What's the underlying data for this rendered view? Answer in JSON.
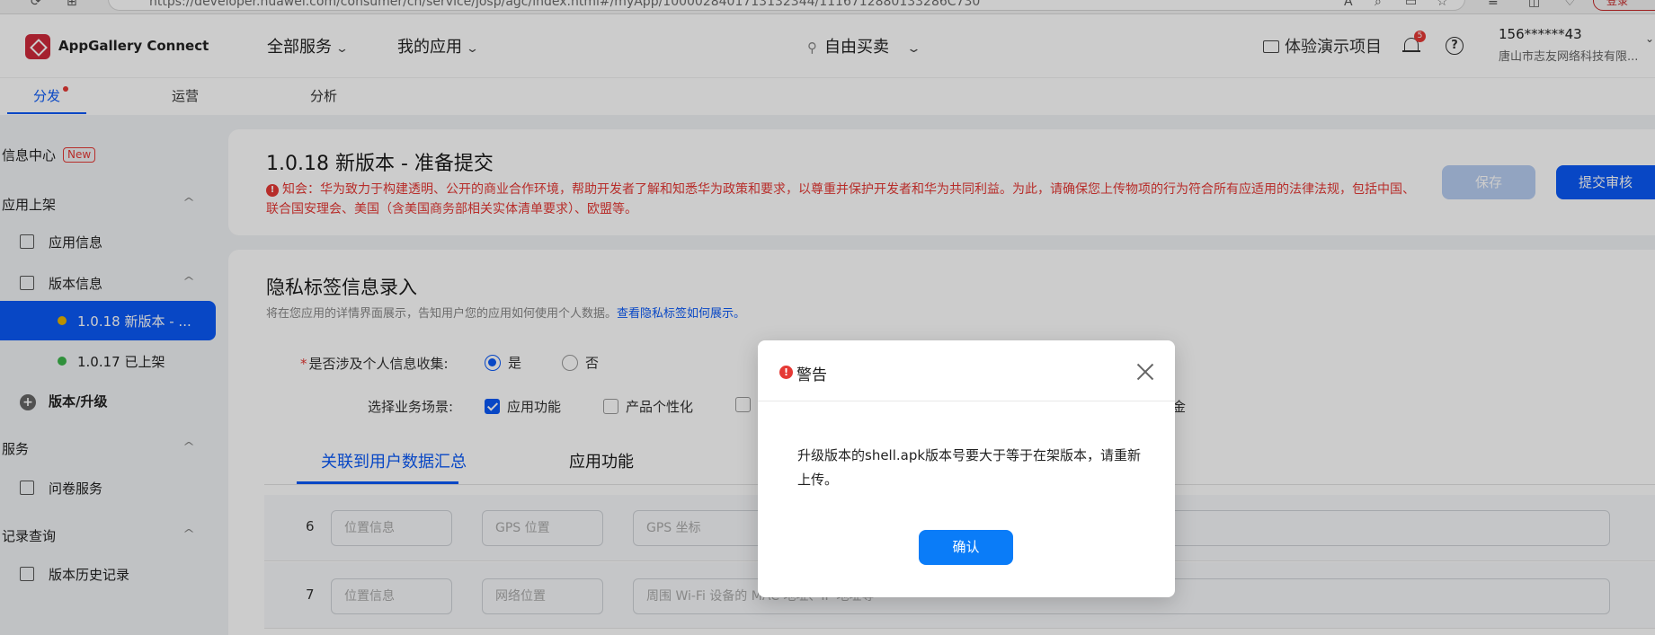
{
  "browser": {
    "url": "https://developer.huawei.com/consumer/cn/service/josp/agc/index.html#/myApp/1000028401713132344/1116712880133286C730",
    "login_label": "登录"
  },
  "header": {
    "brand": "AppGallery Connect",
    "nav_all_services": "全部服务",
    "nav_my_apps": "我的应用",
    "store_name": "自由买卖",
    "demo_project": "体验演示项目",
    "notification_count": "5",
    "help_glyph": "?",
    "user_id": "156******43",
    "user_org": "唐山市志友网络科技有限..."
  },
  "subnav": {
    "tabs": [
      "分发",
      "运营",
      "分析"
    ],
    "active_index": 0
  },
  "sidebar": {
    "info_center": "信息中心",
    "new_badge": "New",
    "section_listing": "应用上架",
    "app_info": "应用信息",
    "version_info": "版本信息",
    "version_current": "1.0.18 新版本 - ...",
    "version_live": "1.0.17 已上架",
    "version_upgrade": "版本/升级",
    "section_service": "服务",
    "survey_service": "问卷服务",
    "section_records": "记录查询",
    "version_history": "版本历史记录"
  },
  "top_card": {
    "title": "1.0.18 新版本 - 准备提交",
    "notice": "知会：华为致力于构建透明、公开的商业合作环境，帮助开发者了解和知悉华为政策和要求，以尊重并保护开发者和华为共同利益。为此，请确保您上传物项的行为符合所有应适用的法律法规，包括中国、联合国安理会、美国（含美国商务部相关实体清单要求）、欧盟等。",
    "save_label": "保存",
    "submit_label": "提交审核"
  },
  "privacy": {
    "title": "隐私标签信息录入",
    "desc": "将在您应用的详情界面展示，告知用户您的应用如何使用个人数据。",
    "desc_link": "查看隐私标签如何展示。",
    "question": "是否涉及个人信息收集:",
    "yes": "是",
    "no": "否",
    "scene_label": "选择业务场景:",
    "scene_app_function": "应用功能",
    "scene_personalization": "产品个性化",
    "scene_trailing": "金",
    "tab_summary": "关联到用户数据汇总",
    "tab_app_function": "应用功能",
    "rows": [
      {
        "num": "6",
        "category": "位置信息",
        "type": "GPS 位置",
        "desc": "GPS 坐标"
      },
      {
        "num": "7",
        "category": "位置信息",
        "type": "网络位置",
        "desc": "周围 Wi-Fi 设备的 MAC 地址、IP 地址等"
      }
    ]
  },
  "modal": {
    "title": "警告",
    "message": "升级版本的shell.apk版本号要大于等于在架版本，请重新上传。",
    "confirm_label": "确认"
  }
}
